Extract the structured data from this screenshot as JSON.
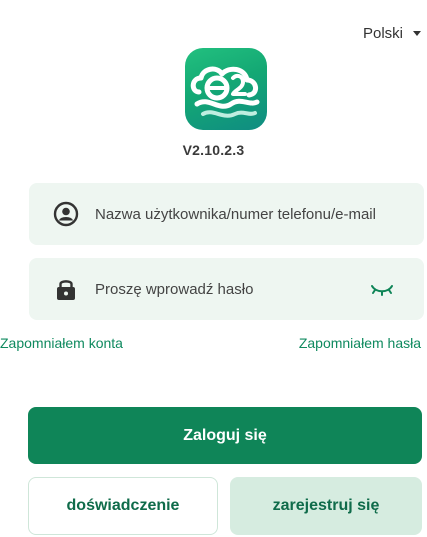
{
  "language": {
    "selected": "Polski",
    "icon": "chevron-down-icon"
  },
  "app": {
    "logo": "e2c-cloud-logo",
    "version": "V2.10.2.3",
    "brand_colors": {
      "primary": "#0f8558",
      "logo_gradient_start": "#22c07f",
      "logo_gradient_end": "#0f8c82"
    }
  },
  "login_form": {
    "username": {
      "placeholder": "Nazwa użytkownika/numer telefonu/e-mail",
      "value": "",
      "icon": "user-icon"
    },
    "password": {
      "placeholder": "Proszę wprowadź hasło",
      "value": "",
      "icon": "lock-icon",
      "toggle_icon": "eye-closed-icon"
    }
  },
  "links": {
    "forgot_account": "Zapomniałem konta",
    "forgot_password": "Zapomniałem hasła"
  },
  "buttons": {
    "login": "Zaloguj się",
    "demo": "doświadczenie",
    "register": "zarejestruj się"
  }
}
